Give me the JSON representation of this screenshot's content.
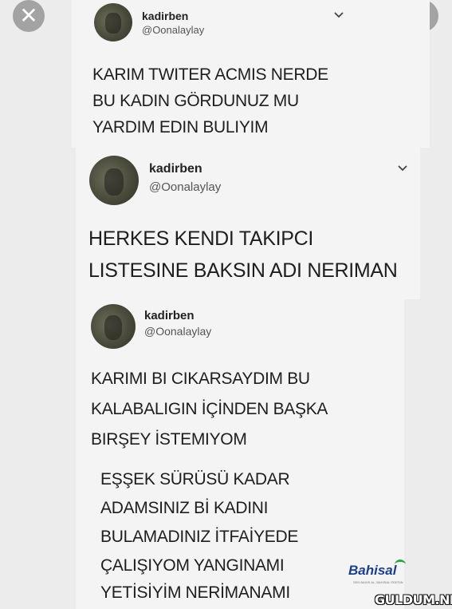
{
  "viewer": {
    "close_icon": "close-icon",
    "lens_icon": "google-lens-icon",
    "more_icon": "more-vertical-icon"
  },
  "tweets": [
    {
      "username": "kadirben",
      "handle": "@Oonalaylay",
      "lines": [
        "KARIM TWITER ACMIS NERDE",
        "BU KADIN GÖRDUNUZ MU",
        "YARDIM EDIN BULIYIM"
      ]
    },
    {
      "username": "kadirben",
      "handle": "@Oonalaylay",
      "lines": [
        "HERKES KENDI TAKIPCI",
        "LISTESINE BAKSIN ADI NERIMAN"
      ]
    },
    {
      "username": "kadirben",
      "handle": "@Oonalaylay",
      "lines": [
        "KARIMI BI CIKARSAYDIM BU",
        "KALABALIGIN İÇİNDEN BAŞKA",
        "BIRŞEY İSTEMIYOM"
      ],
      "extra_lines": [
        "EŞŞEK SÜRÜSÜ KADAR",
        "ADAMSINIZ Bİ KADINI",
        "BULAMADINIZ İTFAİYEDE",
        "ÇALIŞIYOM YANGINAMI",
        "YETİSİYİM NERİMANAMI"
      ]
    }
  ],
  "watermarks": {
    "bahisal": "Bahisal",
    "bahisal_tagline": "SEN BAHIS AL, BAHISAL ÖDESİN",
    "site": "GULDUM.NET"
  }
}
